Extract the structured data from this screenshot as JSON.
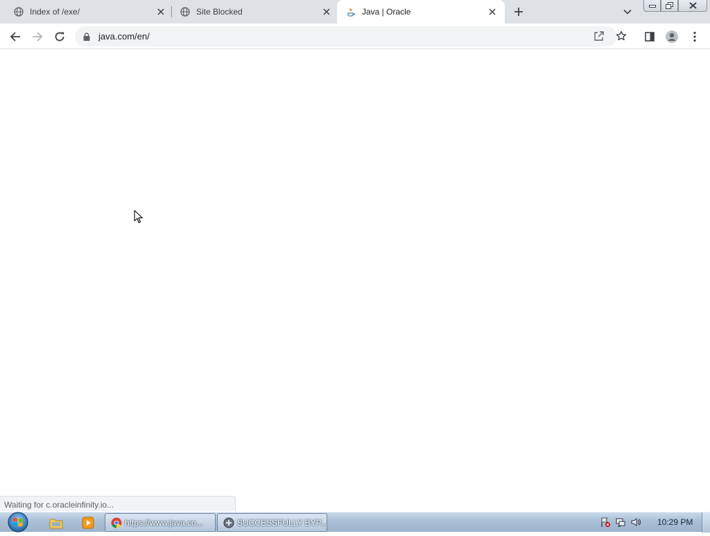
{
  "browser": {
    "tabs": [
      {
        "title": "Index of /exe/",
        "icon": "globe-icon",
        "active": false
      },
      {
        "title": "Site Blocked",
        "icon": "globe-icon",
        "active": false
      },
      {
        "title": "Java | Oracle",
        "icon": "java-icon",
        "active": true
      }
    ],
    "url": "java.com/en/",
    "status_text": "Waiting for c.oracleinfinity.io..."
  },
  "taskbar": {
    "tasks": [
      {
        "label": "https://www.java.co...",
        "icon": "chrome-icon"
      },
      {
        "label": "SUCCESSFULLY BYP...",
        "icon": "app-icon"
      }
    ],
    "clock": "10:29 PM"
  },
  "colors": {
    "tabstrip_bg": "#dee1e6",
    "omnibox_bg": "#f1f3f4",
    "page_bg": "#ffffff"
  }
}
